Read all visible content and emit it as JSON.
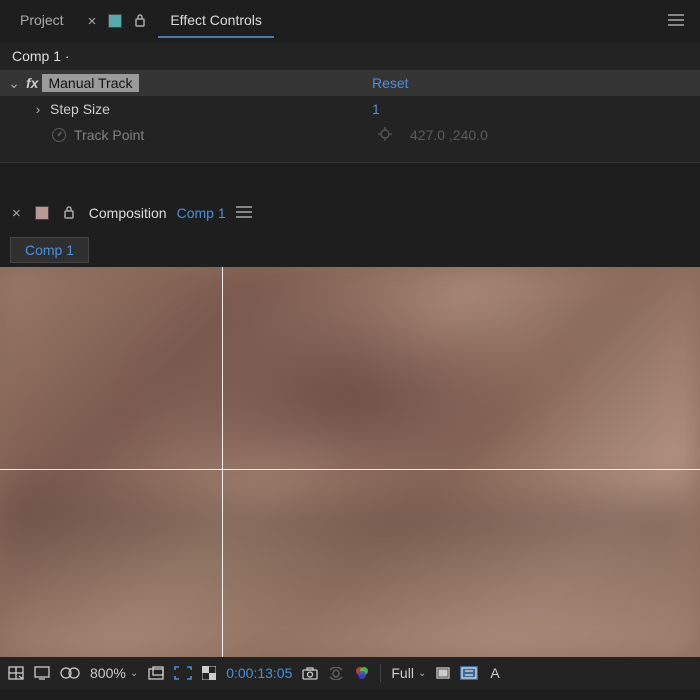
{
  "topPanel": {
    "tabs": {
      "project": "Project",
      "effectControls": "Effect Controls"
    },
    "source": "Comp 1 ·",
    "effect": {
      "name": "Manual Track",
      "reset": "Reset",
      "props": {
        "stepSize": {
          "label": "Step Size",
          "value": "1"
        },
        "trackPoint": {
          "label": "Track Point",
          "x": "427.0",
          "y": "240.0"
        }
      }
    }
  },
  "compPanel": {
    "label": "Composition",
    "name": "Comp 1",
    "breadcrumb": "Comp 1"
  },
  "bottomBar": {
    "zoom": "800%",
    "timecode": "0:00:13:05",
    "resolution": "Full",
    "rightChar": "A"
  },
  "colors": {
    "link": "#4a90d9",
    "panelBg": "#232323",
    "appBg": "#1e1e1e"
  }
}
